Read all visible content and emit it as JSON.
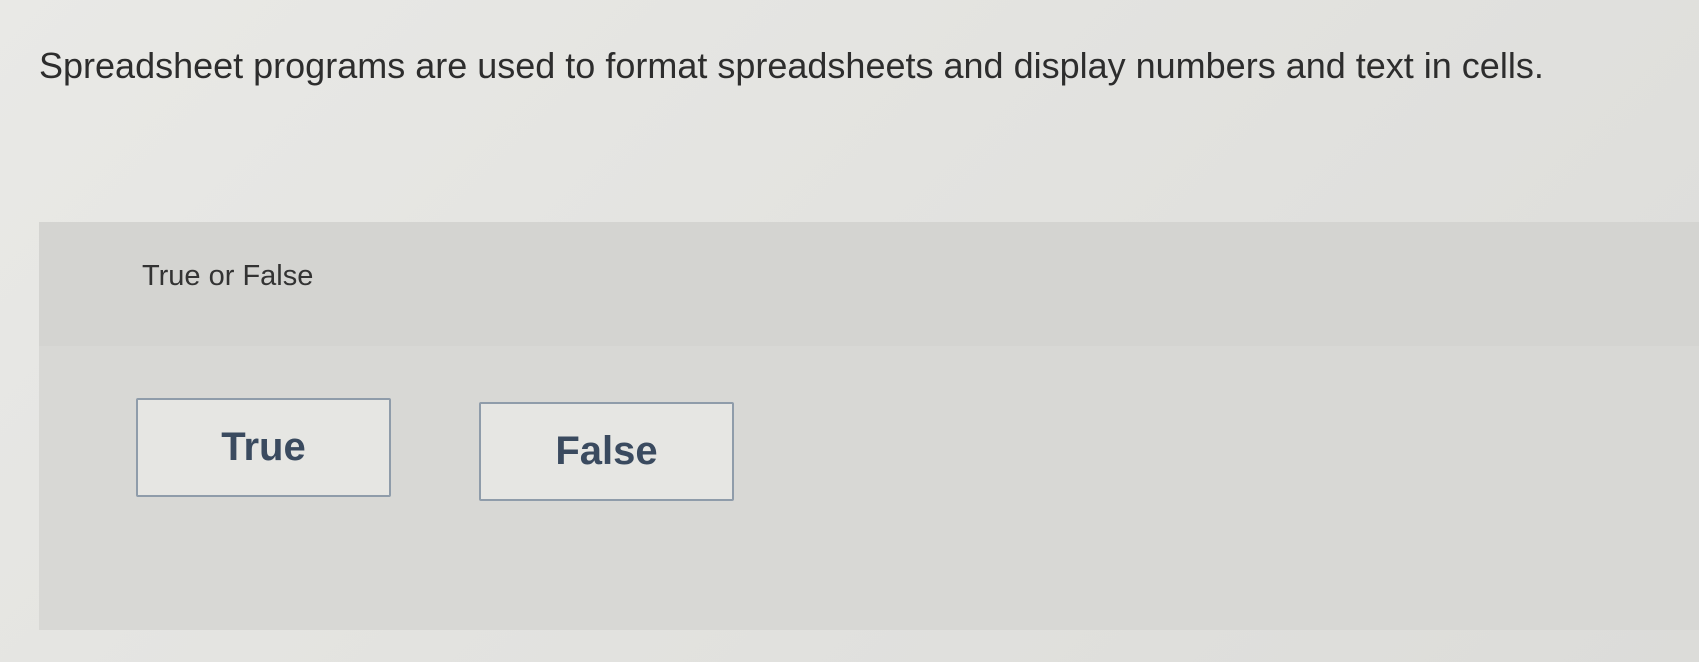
{
  "question": {
    "text": "Spreadsheet programs are used to format spreadsheets and display numbers and text in cells."
  },
  "answer_area": {
    "type_label": "True or False",
    "choices": [
      {
        "label": "True"
      },
      {
        "label": "False"
      }
    ]
  },
  "colors": {
    "page_background": "#e6e6e3",
    "panel_background": "#d8d8d5",
    "button_border": "#8f9caa",
    "button_text": "#3a4a5f"
  }
}
